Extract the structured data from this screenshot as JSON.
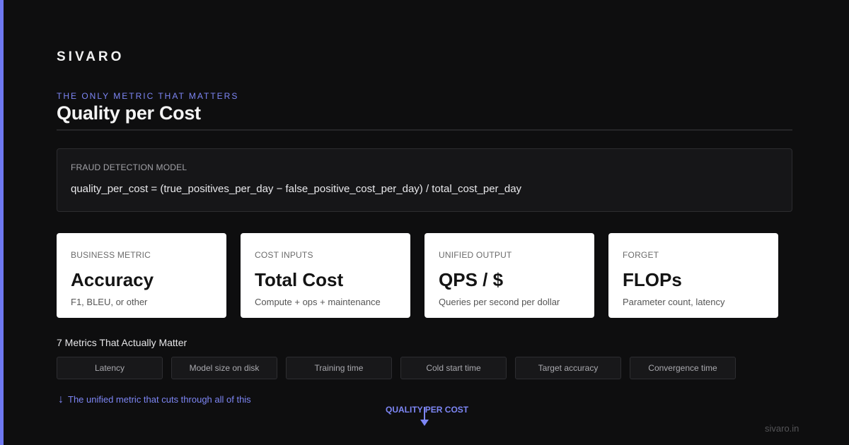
{
  "brand": {
    "logo": "SIVARO",
    "footer": "sivaro.in",
    "accent_color": "#6e78f0"
  },
  "header": {
    "eyebrow": "THE ONLY METRIC THAT MATTERS",
    "title": "Quality per Cost"
  },
  "formula": {
    "label": "FRAUD DETECTION MODEL",
    "expression": "quality_per_cost = (true_positives_per_day − false_positive_cost_per_day) / total_cost_per_day"
  },
  "cards": [
    {
      "label": "BUSINESS METRIC",
      "value": "Accuracy",
      "desc": "F1, BLEU, or other"
    },
    {
      "label": "COST INPUTS",
      "value": "Total Cost",
      "desc": "Compute + ops + maintenance"
    },
    {
      "label": "UNIFIED OUTPUT",
      "value": "QPS / $",
      "desc": "Queries per second per dollar"
    },
    {
      "label": "FORGET",
      "value": "FLOPs",
      "desc": "Parameter count, latency"
    }
  ],
  "metrics": {
    "heading": "7 Metrics That Actually Matter",
    "items": [
      "Latency",
      "Model size on disk",
      "Training time",
      "Cold start time",
      "Target accuracy",
      "Convergence time"
    ]
  },
  "unified": {
    "arrow_icon": "arrow-down-icon",
    "note": "The unified metric that cuts through all of this",
    "label": "QUALITY PER COST"
  }
}
